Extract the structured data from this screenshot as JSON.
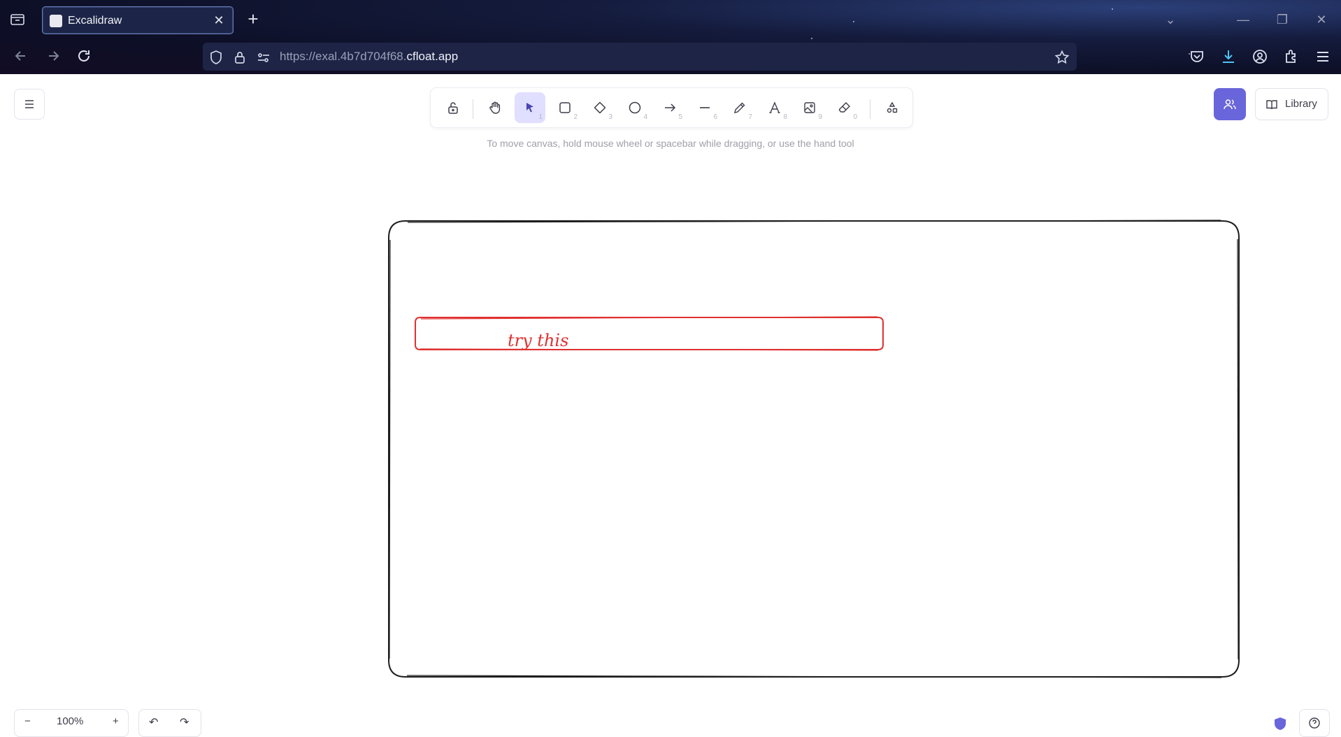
{
  "browser": {
    "tab": {
      "title": "Excalidraw",
      "close_glyph": "✕"
    },
    "new_tab_glyph": "+",
    "url": {
      "prefix": "https://exal.4b7d704f68.",
      "domain": "cfloat.app"
    },
    "icons": [
      "tab-list-icon",
      "back-icon",
      "forward-icon",
      "reload-icon",
      "shield-icon",
      "lock-icon",
      "permissions-icon",
      "bookmark-star-icon",
      "pocket-icon",
      "download-icon",
      "account-icon",
      "extensions-icon",
      "menu-icon"
    ],
    "window_controls": [
      "⌄",
      "—",
      "❐",
      "✕"
    ]
  },
  "app": {
    "toolbar": {
      "tools": [
        {
          "name": "lock",
          "key": ""
        },
        {
          "name": "hand",
          "key": ""
        },
        {
          "name": "selection",
          "key": "1"
        },
        {
          "name": "rectangle",
          "key": "2"
        },
        {
          "name": "diamond",
          "key": "3"
        },
        {
          "name": "ellipse",
          "key": "4"
        },
        {
          "name": "arrow",
          "key": "5"
        },
        {
          "name": "line",
          "key": "6"
        },
        {
          "name": "draw",
          "key": "7"
        },
        {
          "name": "text",
          "key": "8"
        },
        {
          "name": "image",
          "key": "9"
        },
        {
          "name": "eraser",
          "key": "0"
        },
        {
          "name": "extra-tools",
          "key": ""
        }
      ],
      "active_tool": "selection"
    },
    "hint": "To move canvas, hold mouse wheel or spacebar while dragging, or use the hand tool",
    "library_label": "Library",
    "zoom": {
      "minus": "−",
      "level": "100%",
      "plus": "+"
    },
    "undo_glyph": "↶",
    "redo_glyph": "↷",
    "accent_color": "#6965db"
  },
  "canvas": {
    "shapes": [
      {
        "type": "rectangle",
        "stroke": "#1e1e1e",
        "label": ""
      },
      {
        "type": "rectangle",
        "stroke": "#e03131",
        "label": "try this"
      }
    ]
  }
}
